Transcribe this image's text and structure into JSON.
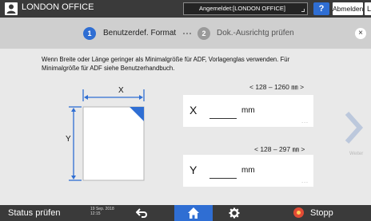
{
  "header": {
    "title": "LONDON OFFICE",
    "login_status": "Angemeldet:[LONDON OFFICE]",
    "help_label": "?",
    "logout_label": "Abmelden",
    "extra_label": "L"
  },
  "steps": [
    {
      "number": "1",
      "label": "Benutzerdef. Format",
      "active": true
    },
    {
      "number": "2",
      "label": "Dok.-Ausrichtg prüfen",
      "active": false
    }
  ],
  "close_label": "×",
  "instruction": "Wenn Breite oder Länge geringer als Minimalgröße für ADF, Vorlagenglas verwenden. Für Minimalgröße für ADF siehe Benutzerhandbuch.",
  "diagram": {
    "x_label": "X",
    "y_label": "Y"
  },
  "fields": {
    "x": {
      "axis": "X",
      "range": "< 128 – 1260 ㎜ >",
      "unit": "mm",
      "value": "",
      "more": "..."
    },
    "y": {
      "axis": "Y",
      "range": "< 128 – 297 ㎜ >",
      "unit": "mm",
      "value": "",
      "more": "..."
    }
  },
  "next_label": "Weiter",
  "footer": {
    "status_label": "Status prüfen",
    "date": "19 Sep. 2018",
    "time": "12:15",
    "stop_label": "Stopp"
  },
  "colors": {
    "accent": "#2f6ed3",
    "bar": "#3a3a3a",
    "stop": "#e14b35"
  },
  "icons": [
    "user-icon",
    "help-icon",
    "close-icon",
    "back-icon",
    "home-icon",
    "gear-icon",
    "stop-icon",
    "next-arrow-icon"
  ]
}
